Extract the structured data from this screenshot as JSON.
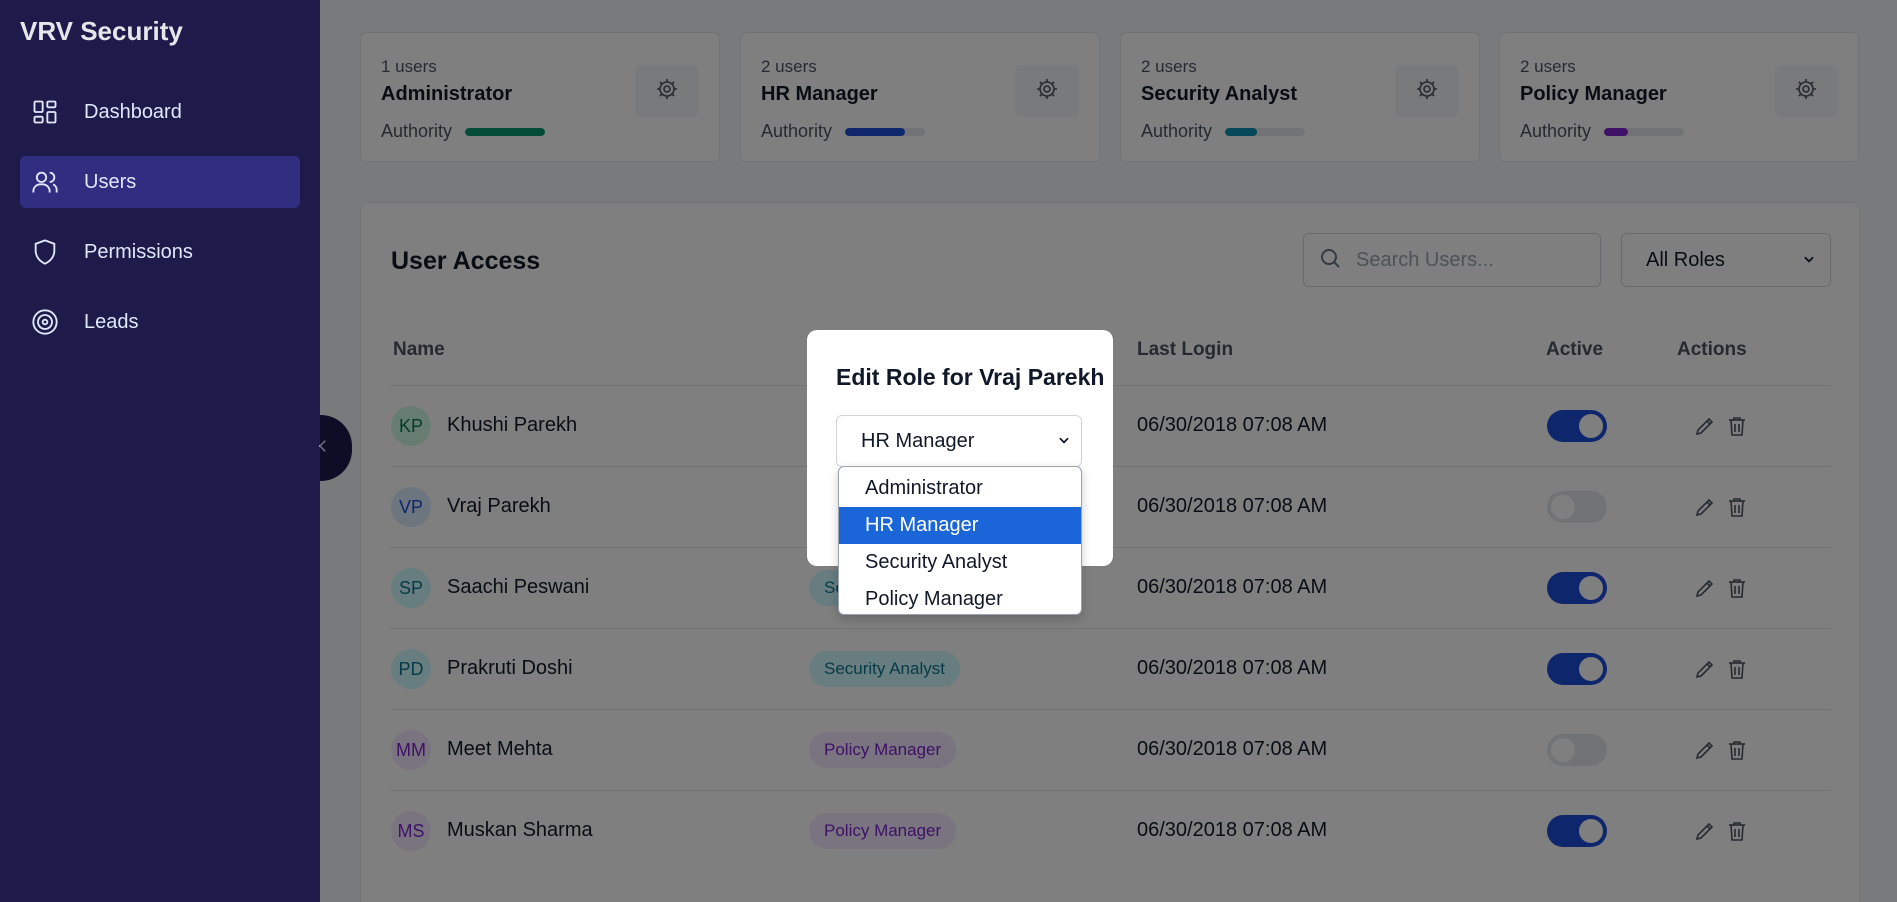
{
  "app": {
    "brand": "VRV Security"
  },
  "sidebar": {
    "items": [
      {
        "label": "Dashboard",
        "icon": "dashboard-icon"
      },
      {
        "label": "Users",
        "icon": "users-icon",
        "active": true
      },
      {
        "label": "Permissions",
        "icon": "shield-icon"
      },
      {
        "label": "Leads",
        "icon": "target-icon"
      }
    ]
  },
  "role_cards": [
    {
      "count": "1 users",
      "name": "Administrator",
      "authority_label": "Authority",
      "authority_level": 1.0,
      "color": "#059669"
    },
    {
      "count": "2 users",
      "name": "HR Manager",
      "authority_label": "Authority",
      "authority_level": 0.75,
      "color": "#1d4ed8"
    },
    {
      "count": "2 users",
      "name": "Security Analyst",
      "authority_label": "Authority",
      "authority_level": 0.4,
      "color": "#0891b2"
    },
    {
      "count": "2 users",
      "name": "Policy Manager",
      "authority_label": "Authority",
      "authority_level": 0.3,
      "color": "#7e22ce"
    }
  ],
  "main": {
    "title": "User Access",
    "search_placeholder": "Search Users...",
    "role_filter": "All Roles",
    "columns": {
      "name": "Name",
      "last_login": "Last Login",
      "active": "Active",
      "actions": "Actions"
    },
    "rows": [
      {
        "initials": "KP",
        "name": "Khushi Parekh",
        "role": "",
        "last_login": "06/30/2018 07:08 AM",
        "active": true,
        "avatar_bg": "#d1fae5",
        "avatar_fg": "#047857"
      },
      {
        "initials": "VP",
        "name": "Vraj Parekh",
        "role": "",
        "last_login": "06/30/2018 07:08 AM",
        "active": false,
        "avatar_bg": "#dbeafe",
        "avatar_fg": "#1d4ed8"
      },
      {
        "initials": "SP",
        "name": "Saachi Peswani",
        "role": "Se",
        "last_login": "06/30/2018 07:08 AM",
        "active": true,
        "avatar_bg": "#cffafe",
        "avatar_fg": "#0e7490",
        "badge_bg": "#cffafe",
        "badge_fg": "#0e7490"
      },
      {
        "initials": "PD",
        "name": "Prakruti Doshi",
        "role": "Security Analyst",
        "last_login": "06/30/2018 07:08 AM",
        "active": true,
        "avatar_bg": "#cffafe",
        "avatar_fg": "#0e7490",
        "badge_bg": "#cffafe",
        "badge_fg": "#0e7490"
      },
      {
        "initials": "MM",
        "name": "Meet Mehta",
        "role": "Policy Manager",
        "last_login": "06/30/2018 07:08 AM",
        "active": false,
        "avatar_bg": "#f3e8ff",
        "avatar_fg": "#7e22ce",
        "badge_bg": "#f3e8ff",
        "badge_fg": "#7e22ce"
      },
      {
        "initials": "MS",
        "name": "Muskan Sharma",
        "role": "Policy Manager",
        "last_login": "06/30/2018 07:08 AM",
        "active": true,
        "avatar_bg": "#f3e8ff",
        "avatar_fg": "#7e22ce",
        "badge_bg": "#f3e8ff",
        "badge_fg": "#7e22ce"
      }
    ]
  },
  "modal": {
    "title": "Edit Role for Vraj Parekh",
    "selected": "HR Manager",
    "options": [
      "Administrator",
      "HR Manager",
      "Security Analyst",
      "Policy Manager"
    ]
  }
}
